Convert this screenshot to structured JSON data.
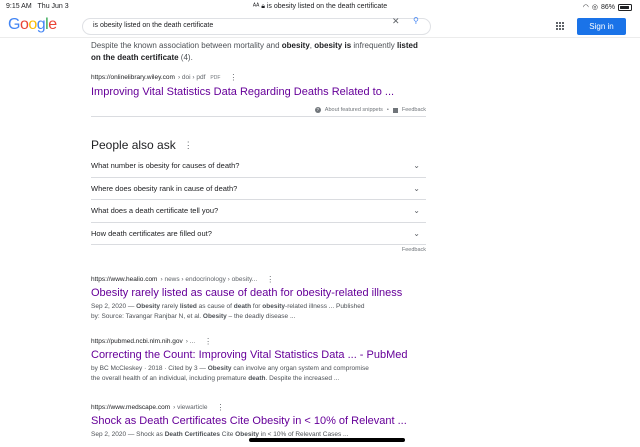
{
  "status_bar": {
    "time": "9:15 AM",
    "day": "Thu Jun 3",
    "url": "is obesity listed on the death certificate",
    "battery": "86%",
    "battery_level": 0.86
  },
  "header": {
    "logo_letters": [
      "G",
      "o",
      "o",
      "g",
      "l",
      "e"
    ],
    "search_value": "is obesity listed on the death certificate",
    "sign_in_label": "Sign in"
  },
  "featured": {
    "snippet_parts": [
      "Despite the known association between mortality and ",
      "obesity",
      ", ",
      "obesity is",
      " infrequently ",
      "listed on the death certificate",
      " (4)."
    ],
    "cite_site": "https://onlinelibrary.wiley.com",
    "cite_path": "› doi › pdf",
    "cite_type": "PDF",
    "title": "Improving Vital Statistics Data Regarding Deaths Related to ...",
    "about_label": "About featured snippets",
    "separator": "•",
    "feedback_label": "Feedback"
  },
  "paa": {
    "heading": "People also ask",
    "questions": [
      "What number is obesity for causes of death?",
      "Where does obesity rank in cause of death?",
      "What does a death certificate tell you?",
      "How death certificates are filled out?"
    ],
    "feedback_label": "Feedback"
  },
  "results": [
    {
      "site": "https://www.healio.com",
      "path": "› news › endocrinology › obesity...",
      "title": "Obesity rarely listed as cause of death for obesity-related illness",
      "line1": [
        "Sep 2, 2020 — ",
        "Obesity",
        " rarely ",
        "listed",
        " as cause of ",
        "death",
        " for ",
        "obesity",
        "-related illness ... Published"
      ],
      "line2": [
        "by: Source: Tavangar Ranjbar N, et al. ",
        "Obesity",
        " – the deadly disease ..."
      ]
    },
    {
      "site": "https://pubmed.ncbi.nlm.nih.gov",
      "path": "› ...",
      "title": "Correcting the Count: Improving Vital Statistics Data ... - PubMed",
      "line1": [
        "by BC McCleskey · 2018 · Cited by 3 — ",
        "Obesity",
        " can involve any organ system and compromise"
      ],
      "line2": [
        "the overall health of an individual, including premature ",
        "death",
        ". Despite the increased ..."
      ]
    },
    {
      "site": "https://www.medscape.com",
      "path": "› viewarticle",
      "title": "Shock as Death Certificates Cite Obesity in < 10% of Relevant ...",
      "line1": [
        "Sep 2, 2020 — Shock as ",
        "Death Certificates",
        " Cite ",
        "Obesity",
        " in < 10% of Relevant Cases ..."
      ],
      "line2": []
    }
  ],
  "icons": {
    "close": "close-icon",
    "search": "search-icon",
    "apps": "apps-grid-icon",
    "more": "more-vert-icon",
    "chevron": "chevron-down-icon",
    "question": "question-icon",
    "flag": "feedback-flag-icon"
  },
  "colors": {
    "link_visited": "#660099",
    "signin_bg": "#1a73e8",
    "logo_blue": "#4285f4",
    "logo_red": "#ea4335",
    "logo_yellow": "#fbbc05",
    "logo_green": "#34a853"
  }
}
